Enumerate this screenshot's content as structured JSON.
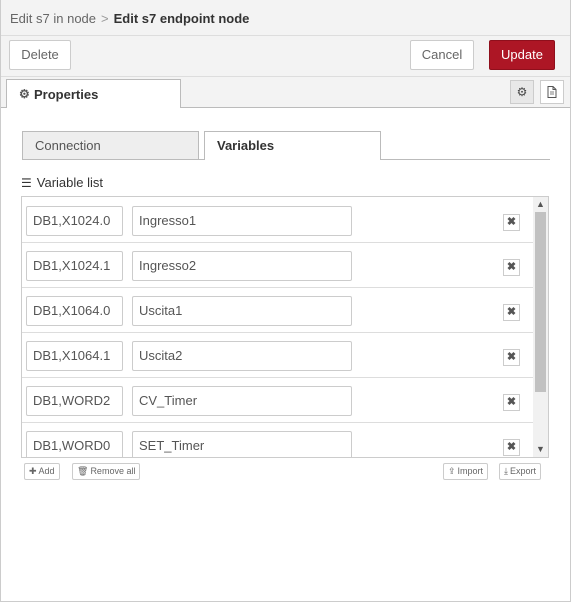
{
  "header": {
    "breadcrumb_parent": "Edit s7 in node",
    "separator": ">",
    "title": "Edit s7 endpoint node"
  },
  "toolbar": {
    "delete_label": "Delete",
    "cancel_label": "Cancel",
    "update_label": "Update"
  },
  "colors": {
    "update_button": "#ad1625"
  },
  "tabs": {
    "properties_label": "Properties",
    "properties_icon": "gear-icon",
    "side_buttons": [
      "gear-icon",
      "document-icon"
    ]
  },
  "inner_tabs": {
    "connection_label": "Connection",
    "variables_label": "Variables",
    "active": "Variables"
  },
  "variables": {
    "list_label": "Variable list",
    "list_icon": "list-icon",
    "rows": [
      {
        "address": "DB1,X1024.0",
        "name": "Ingresso1"
      },
      {
        "address": "DB1,X1024.1",
        "name": "Ingresso2"
      },
      {
        "address": "DB1,X1064.0",
        "name": "Uscita1"
      },
      {
        "address": "DB1,X1064.1",
        "name": "Uscita2"
      },
      {
        "address": "DB1,WORD2",
        "name": "CV_Timer"
      },
      {
        "address": "DB1,WORD0",
        "name": "SET_Timer"
      }
    ],
    "add_label": "Add",
    "remove_all_label": "Remove all",
    "import_label": "Import",
    "export_label": "Export"
  }
}
